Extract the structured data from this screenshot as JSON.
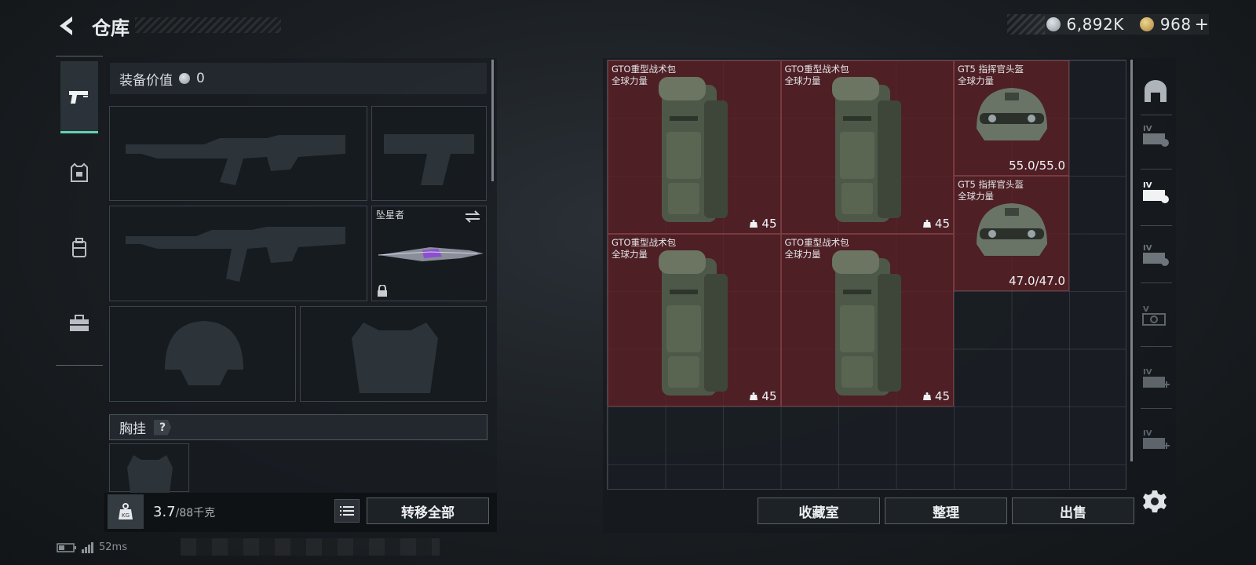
{
  "header": {
    "title": "仓库",
    "currency_silver": "6,892K",
    "currency_gold": "968",
    "plus_label": "+"
  },
  "left_nav": {
    "items": [
      "weapons-icon",
      "armor-icon",
      "backpack-icon",
      "toolbox-icon"
    ],
    "active_index": 0
  },
  "equipment": {
    "value_label": "装备价值",
    "value": "0",
    "melee_name": "坠星者",
    "chest_label": "胸挂",
    "help_label": "?"
  },
  "footer_left": {
    "weight_value": "3.7",
    "weight_max": "/88千克",
    "transfer_all": "转移全部"
  },
  "stash_items": [
    {
      "name": "GTO重型战术包",
      "tag": "全球力量",
      "value": "45",
      "kind": "backpack"
    },
    {
      "name": "GTO重型战术包",
      "tag": "全球力量",
      "value": "45",
      "kind": "backpack"
    },
    {
      "name": "GT5 指挥官头盔",
      "tag": "全球力量",
      "value": "55.0/55.0",
      "kind": "helmet"
    },
    {
      "name": "GT5 指挥官头盔",
      "tag": "全球力量",
      "value": "47.0/47.0",
      "kind": "helmet"
    },
    {
      "name": "GTO重型战术包",
      "tag": "全球力量",
      "value": "45",
      "kind": "backpack"
    },
    {
      "name": "GTO重型战术包",
      "tag": "全球力量",
      "value": "45",
      "kind": "backpack"
    }
  ],
  "bottom_buttons": {
    "collection": "收藏室",
    "organize": "整理",
    "sell": "出售"
  },
  "side_tabs": [
    "IV",
    "IV",
    "IV",
    "V",
    "IV",
    "IV"
  ],
  "status": {
    "ping": "52ms"
  },
  "colors": {
    "accent": "#5fd1b0",
    "item_bg": "#6a2026"
  }
}
